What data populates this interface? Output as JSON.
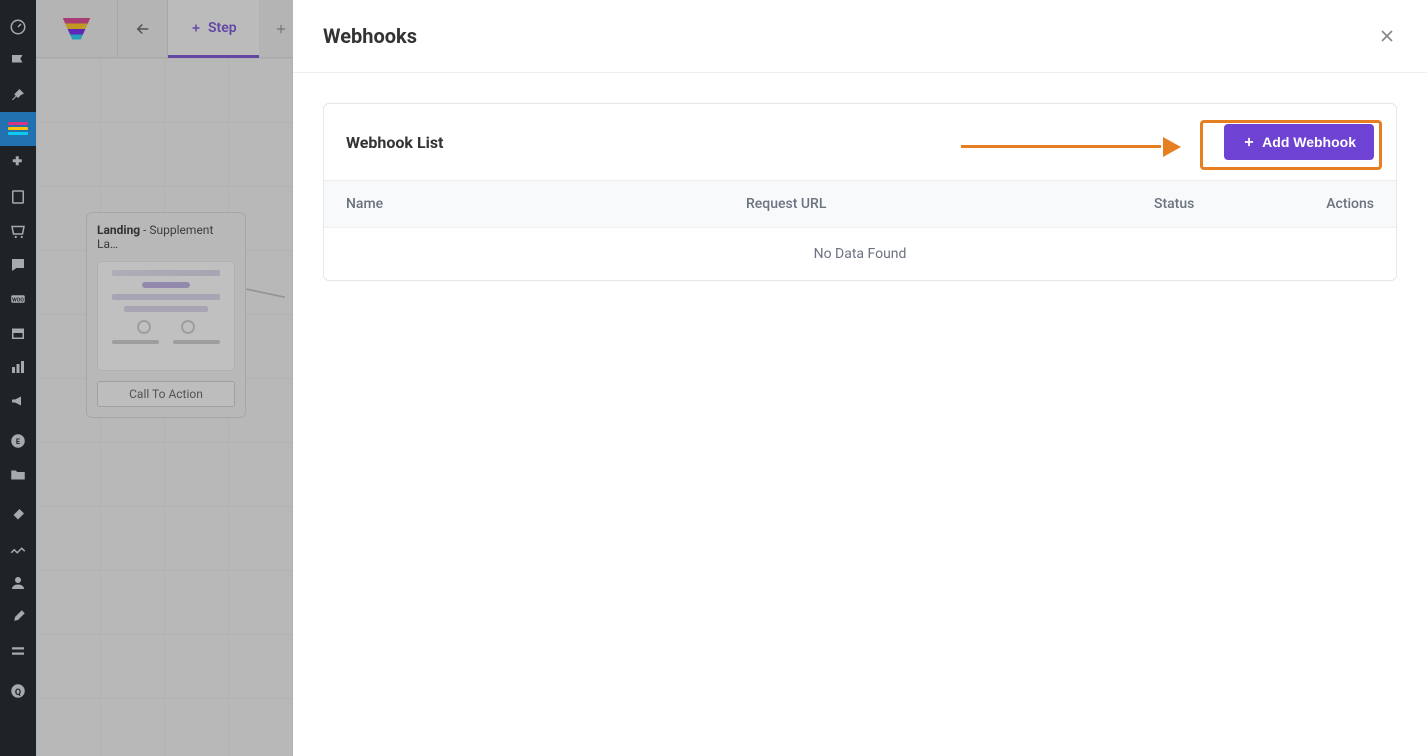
{
  "brand_colors": {
    "primary": "#6e42d3",
    "highlight": "#e67e22"
  },
  "topbar": {
    "step_tab_label": "Step"
  },
  "node": {
    "title_prefix": "Landing",
    "title_suffix": " - Supplement La…",
    "cta_label": "Call To Action"
  },
  "modal": {
    "title": "Webhooks"
  },
  "panel": {
    "title": "Webhook List",
    "add_button_label": "Add Webhook"
  },
  "table": {
    "columns": {
      "name": "Name",
      "url": "Request URL",
      "status": "Status",
      "actions": "Actions"
    },
    "empty_message": "No Data Found"
  }
}
